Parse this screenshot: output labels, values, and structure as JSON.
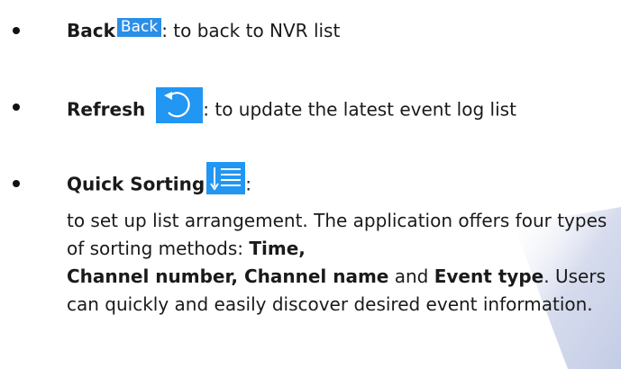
{
  "items": [
    {
      "label": "Back",
      "icon": "back-button-icon",
      "icon_text": "Back",
      "description": ": to back to NVR list"
    },
    {
      "label": "Refresh",
      "icon": "refresh-icon",
      "description": ": to update the latest event log list"
    },
    {
      "label": "Quick Sorting",
      "icon": "sort-list-icon",
      "description": ":"
    }
  ],
  "sorting_paragraph": {
    "intro": " to set up list arrangement. The application offers four types of sorting methods: ",
    "method_1": "Time,",
    "method_2": "Channel number, Channel name",
    "connector": " and ",
    "method_3": "Event type",
    "outro": ". Users can quickly and easily discover desired event information."
  },
  "colors": {
    "icon_blue": "#2196f3",
    "back_blue": "#2b8fe6",
    "text": "#1a1a1a",
    "watermark": "#cfd6ea"
  }
}
